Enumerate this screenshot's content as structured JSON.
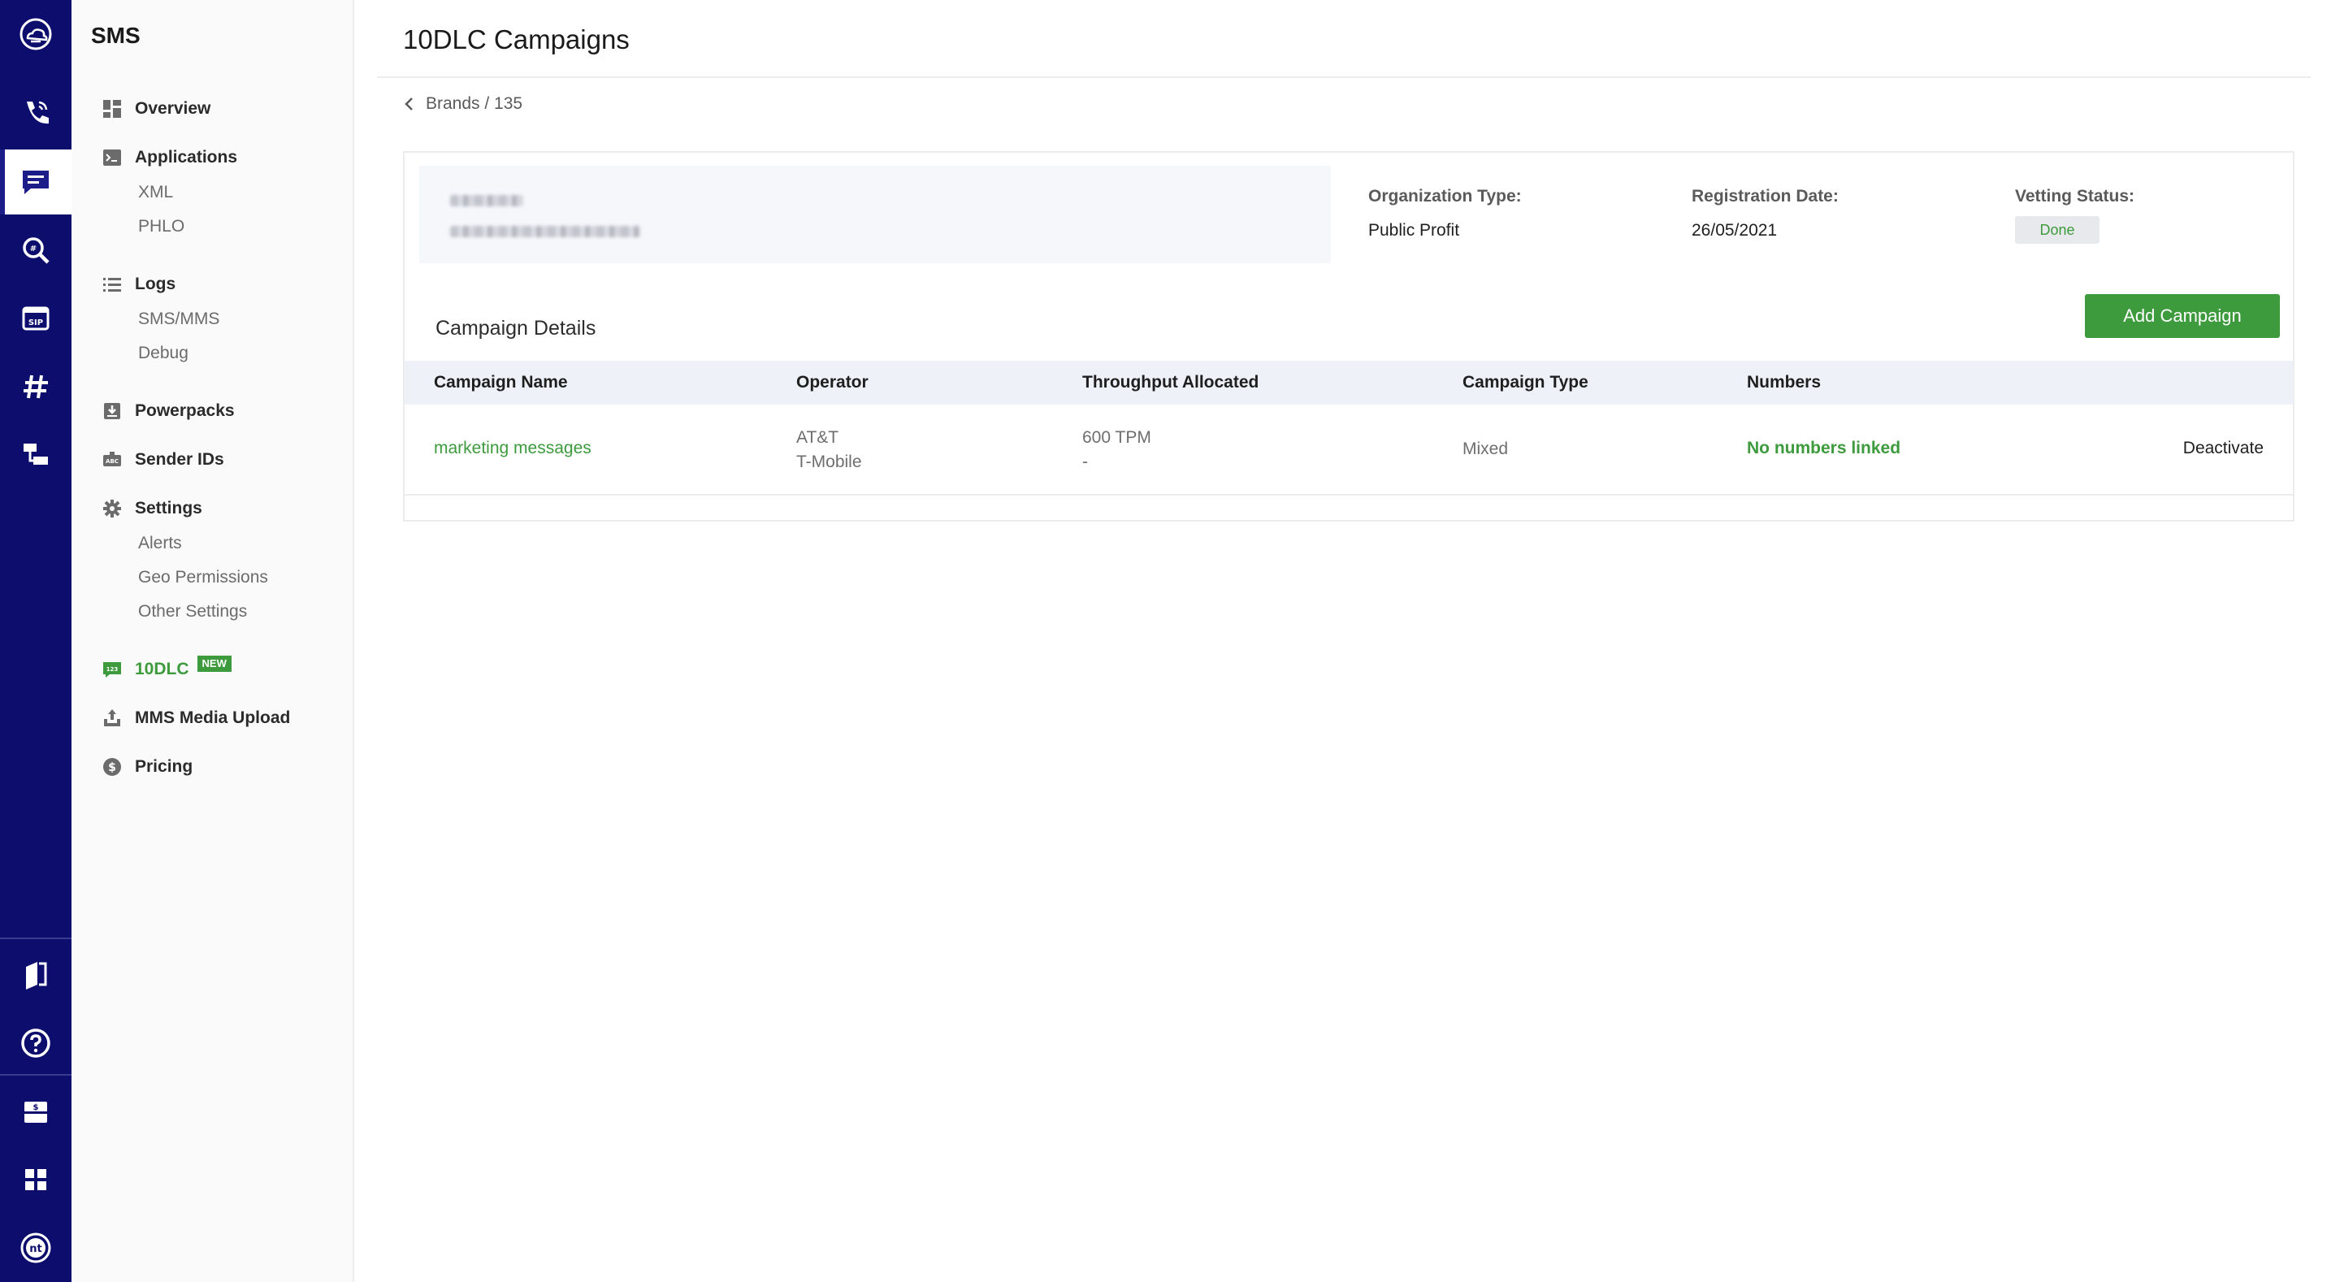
{
  "rail": {
    "top_icons": [
      "cloud-logo-icon",
      "voice-call-icon",
      "sms-message-icon",
      "number-lookup-icon",
      "sip-trunk-icon",
      "phone-numbers-hash-icon",
      "flow-builder-icon"
    ],
    "bottom_icons": [
      "docs-book-icon",
      "help-icon",
      "billing-icon",
      "apps-grid-icon",
      "account-avatar-icon"
    ],
    "active": "sms-message-icon"
  },
  "sidebar": {
    "title": "SMS",
    "items": {
      "overview": "Overview",
      "applications": "Applications",
      "xml": "XML",
      "phlo": "PHLO",
      "logs": "Logs",
      "sms_mms": "SMS/MMS",
      "debug": "Debug",
      "powerpacks": "Powerpacks",
      "sender_ids": "Sender IDs",
      "settings": "Settings",
      "alerts": "Alerts",
      "geo_permissions": "Geo Permissions",
      "other_settings": "Other Settings",
      "tendlc": "10DLC",
      "tendlc_badge": "NEW",
      "mms_media_upload": "MMS Media Upload",
      "pricing": "Pricing"
    }
  },
  "header": {
    "title": "10DLC Campaigns",
    "breadcrumb": "Brands / 135"
  },
  "brand": {
    "org_type_label": "Organization Type:",
    "org_type_value": "Public Profit",
    "reg_date_label": "Registration Date:",
    "reg_date_value": "26/05/2021",
    "vetting_label": "Vetting Status:",
    "vetting_value": "Done"
  },
  "campaigns": {
    "section_title": "Campaign Details",
    "add_button": "Add Campaign",
    "columns": [
      "Campaign Name",
      "Operator",
      "Throughput Allocated",
      "Campaign Type",
      "Numbers"
    ],
    "rows": [
      {
        "name": "marketing messages",
        "operator_1": "AT&T",
        "operator_2": "T-Mobile",
        "throughput_1": "600 TPM",
        "throughput_2": "-",
        "type": "Mixed",
        "numbers": "No numbers linked",
        "action": "Deactivate"
      }
    ]
  },
  "colors": {
    "rail_bg": "#0d0d6e",
    "accent_green": "#3d9a3d",
    "table_header_bg": "#eef1f8"
  }
}
